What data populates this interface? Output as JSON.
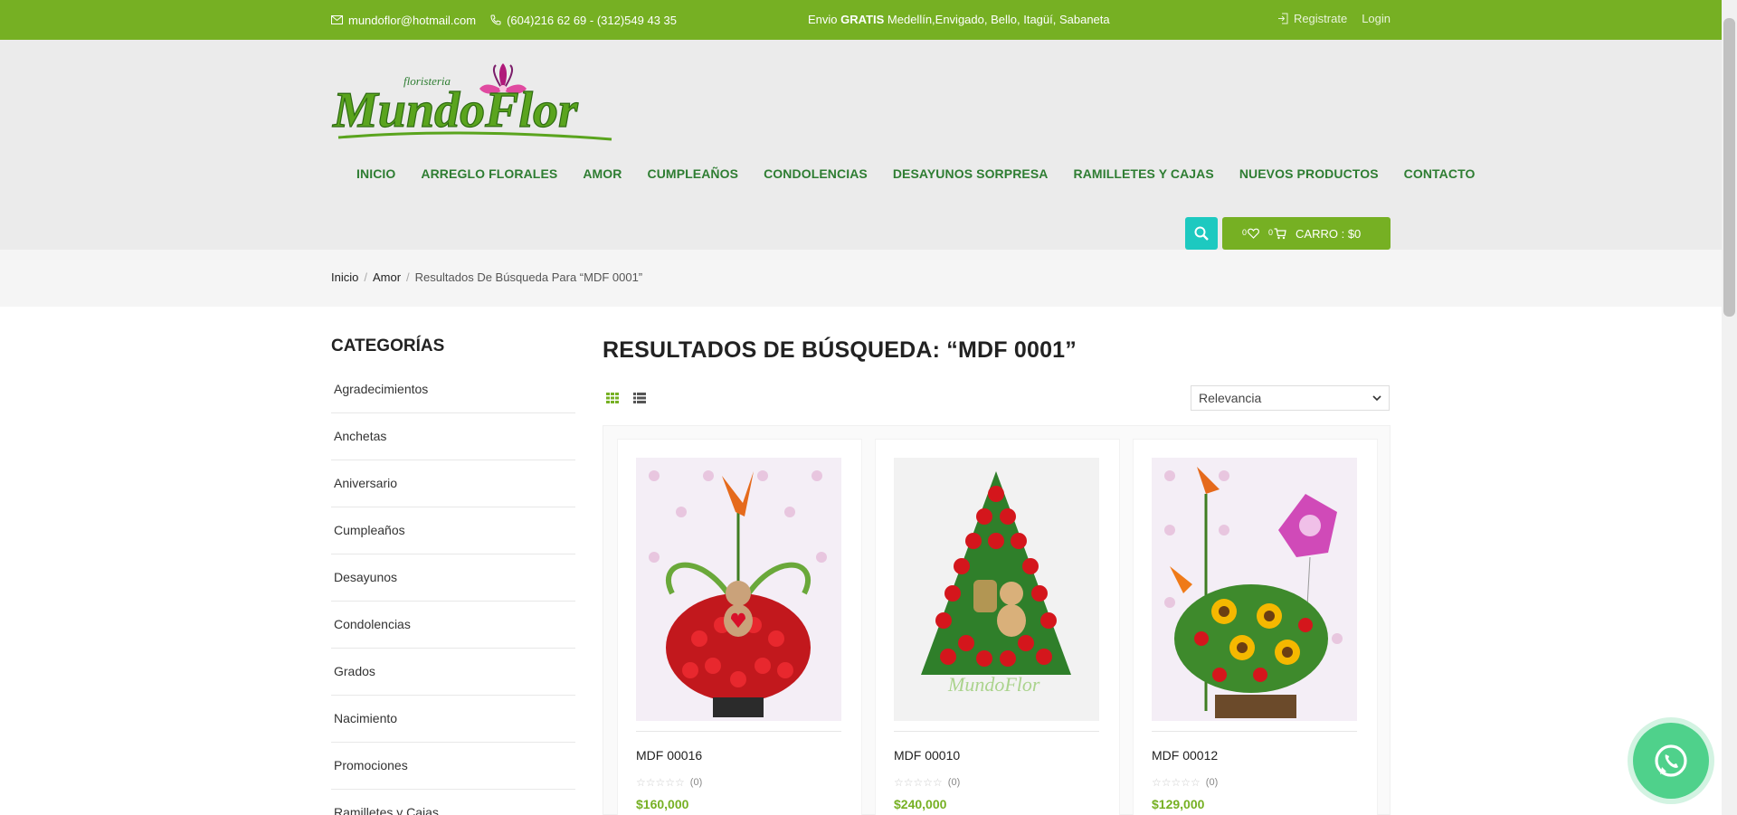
{
  "topbar": {
    "email": "mundoflor@hotmail.com",
    "phone": "(604)216 62 69 - (312)549 43 35",
    "shipping_prefix": "Envio ",
    "shipping_bold": "GRATIS",
    "shipping_suffix": " Medellín,Envigado, Bello, Itagüí, Sabaneta",
    "register": "Registrate",
    "login": "Login"
  },
  "logo": {
    "small": "floristeria",
    "main": "MundoFlor"
  },
  "nav": [
    "INICIO",
    "ARREGLO FLORALES",
    "AMOR",
    "CUMPLEAÑOS",
    "CONDOLENCIAS",
    "DESAYUNOS SORPRESA",
    "RAMILLETES Y CAJAS",
    "NUEVOS PRODUCTOS",
    "CONTACTO"
  ],
  "cart": {
    "wish_count": "0",
    "cart_count": "0",
    "label": "CARRO : $0"
  },
  "breadcrumb": [
    "Inicio",
    "Amor",
    "Resultados De Búsqueda Para “MDF 0001”"
  ],
  "sidebar": {
    "title": "CATEGORÍAS",
    "items": [
      "Agradecimientos",
      "Anchetas",
      "Aniversario",
      "Cumpleaños",
      "Desayunos",
      "Condolencias",
      "Grados",
      "Nacimiento",
      "Promociones",
      "Ramilletes y Cajas"
    ]
  },
  "results": {
    "title": "RESULTADOS DE BÚSQUEDA: “MDF 0001”",
    "sort_selected": "Relevancia",
    "products": [
      {
        "name": "MDF 00016",
        "reviews": "(0)",
        "price": "$160,000"
      },
      {
        "name": "MDF 00010",
        "reviews": "(0)",
        "price": "$240,000"
      },
      {
        "name": "MDF 00012",
        "reviews": "(0)",
        "price": "$129,000"
      }
    ]
  },
  "colors": {
    "brand_green": "#76b023",
    "nav_green": "#2e7d32",
    "search_teal": "#1dc9c0",
    "whatsapp": "#4fd18b"
  }
}
